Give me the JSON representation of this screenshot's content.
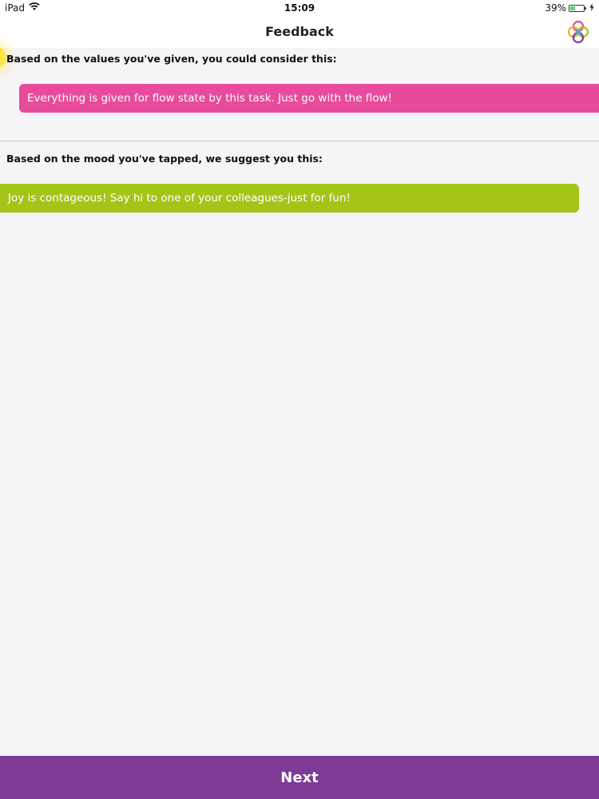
{
  "status_bar": {
    "device": "iPad",
    "time": "15:09",
    "battery_percent": "39%",
    "battery_level": 0.39,
    "icons": [
      "wifi-icon",
      "battery-icon",
      "charging-bolt-icon"
    ]
  },
  "nav": {
    "title": "Feedback",
    "logo_icon": "app-logo-icon"
  },
  "sections": [
    {
      "label": "Based on the values you've given, you could consider this:",
      "message": "Everything is given for flow state by this task. Just go with the flow!",
      "color": "#e84b9b"
    },
    {
      "label": "Based on the mood you've tapped, we suggest you this:",
      "message": "Joy is contageous! Say hi to one of your colleagues-just for fun!",
      "color": "#a3c519"
    }
  ],
  "footer": {
    "next_label": "Next",
    "color": "#7e3b96"
  }
}
